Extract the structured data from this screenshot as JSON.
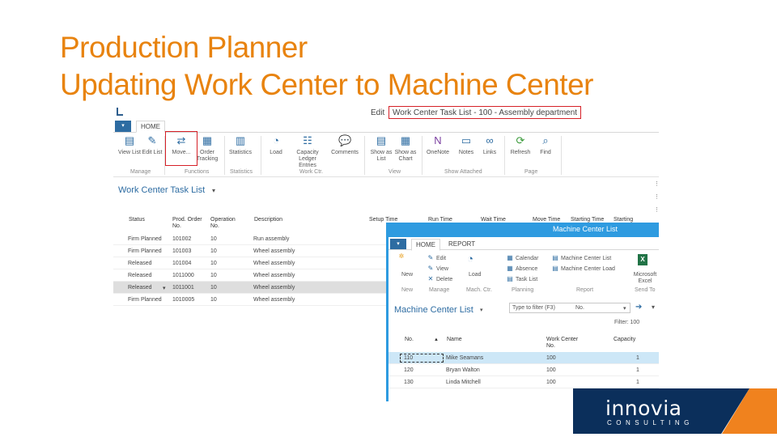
{
  "slide": {
    "title_line1": "Production Planner",
    "title_line2": "Updating Work Center to Machine Center"
  },
  "window1": {
    "title_prefix": "Edit",
    "title": "Work Center Task List - 100 - Assembly department",
    "tab_menu": "▾",
    "tab_home": "HOME",
    "ribbon": [
      {
        "label": "View List",
        "icon": "view-list-icon"
      },
      {
        "label": "Edit List",
        "icon": "edit-list-icon"
      },
      {
        "label": "Move...",
        "icon": "move-arrows-icon"
      },
      {
        "label": "Order Tracking",
        "icon": "order-tracking-icon"
      },
      {
        "label": "Statistics",
        "icon": "statistics-icon"
      },
      {
        "label": "Load",
        "icon": "load-icon"
      },
      {
        "label": "Capacity Ledger Entries",
        "icon": "capacity-ledger-icon"
      },
      {
        "label": "Comments",
        "icon": "comments-icon"
      },
      {
        "label": "Show as List",
        "icon": "show-list-icon"
      },
      {
        "label": "Show as Chart",
        "icon": "show-chart-icon"
      },
      {
        "label": "OneNote",
        "icon": "onenote-icon"
      },
      {
        "label": "Notes",
        "icon": "notes-icon"
      },
      {
        "label": "Links",
        "icon": "links-icon"
      },
      {
        "label": "Refresh",
        "icon": "refresh-icon"
      },
      {
        "label": "Find",
        "icon": "find-icon"
      }
    ],
    "groups": {
      "manage": "Manage",
      "functions": "Functions",
      "statistics": "Statistics",
      "work_ctr": "Work Ctr.",
      "view": "View",
      "show_attached": "Show Attached",
      "page": "Page"
    },
    "page_title": "Work Center Task List",
    "columns": {
      "status": "Status",
      "prod_order_no": "Prod. Order No.",
      "operation_no": "Operation No.",
      "description": "Description",
      "setup_time": "Setup Time",
      "run_time": "Run Time",
      "wait_time": "Wait Time",
      "move_time": "Move Time",
      "starting_time": "Starting Time",
      "starting": "Starting"
    },
    "rows": [
      {
        "status": "Firm Planned",
        "order": "101002",
        "op": "10",
        "desc": "Run assembly"
      },
      {
        "status": "Firm Planned",
        "order": "101003",
        "op": "10",
        "desc": "Wheel assembly"
      },
      {
        "status": "Released",
        "order": "101004",
        "op": "10",
        "desc": "Wheel assembly"
      },
      {
        "status": "Released",
        "order": "1011000",
        "op": "10",
        "desc": "Wheel assembly"
      },
      {
        "status": "Released",
        "order": "1011001",
        "op": "10",
        "desc": "Wheel assembly"
      },
      {
        "status": "Firm Planned",
        "order": "1010005",
        "op": "10",
        "desc": "Wheel assembly"
      }
    ]
  },
  "window2": {
    "title": "Machine Center List",
    "tab_menu": "▾",
    "tab_home": "HOME",
    "tab_report": "REPORT",
    "ribbon": {
      "new": "New",
      "edit": "Edit",
      "view": "View",
      "delete": "Delete",
      "load": "Load",
      "calendar": "Calendar",
      "absence": "Absence",
      "task_list": "Task List",
      "machine_center_list": "Machine Center List",
      "machine_center_load": "Machine Center Load",
      "excel": "Microsoft Excel"
    },
    "groups": {
      "new": "New",
      "manage": "Manage",
      "mach_ctr": "Mach. Ctr.",
      "planning": "Planning",
      "report": "Report",
      "send_to": "Send To"
    },
    "page_title": "Machine Center List",
    "filter_placeholder": "Type to filter (F3)",
    "filter_field": "No.",
    "filter_status": "Filter: 100",
    "columns": {
      "no": "No.",
      "name": "Name",
      "work_center_no": "Work Center No.",
      "capacity": "Capacity"
    },
    "rows": [
      {
        "no": "110",
        "name": "Mike Seamans",
        "wc": "100",
        "cap": "1"
      },
      {
        "no": "120",
        "name": "Bryan Walton",
        "wc": "100",
        "cap": "1"
      },
      {
        "no": "130",
        "name": "Linda Mitchell",
        "wc": "100",
        "cap": "1"
      }
    ]
  },
  "logo": {
    "name": "innovia",
    "subtitle": "CONSULTING"
  }
}
